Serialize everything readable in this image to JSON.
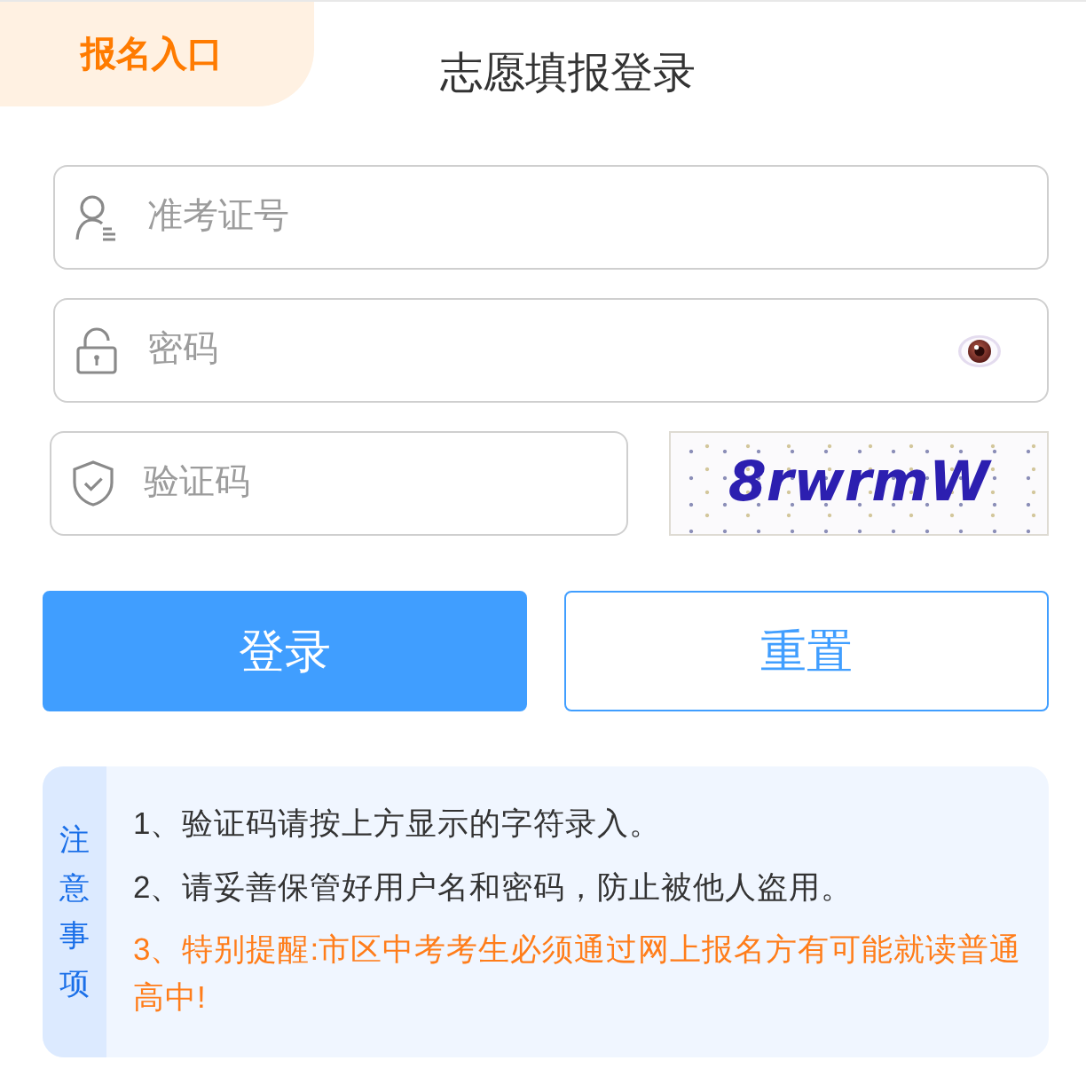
{
  "header": {
    "tab": "报名入口",
    "title": "志愿填报登录"
  },
  "form": {
    "fields": [
      {
        "kind": "username",
        "placeholder": "准考证号"
      },
      {
        "kind": "password",
        "placeholder": "密码"
      },
      {
        "kind": "captcha",
        "placeholder": "验证码"
      }
    ],
    "captcha_image": {
      "text": "8rwrmW"
    }
  },
  "buttons": [
    {
      "kind": "primary",
      "label": "登录"
    },
    {
      "kind": "outline",
      "label": "重置"
    }
  ],
  "notice": {
    "heading": "注意事项",
    "items": [
      {
        "kind": "normal",
        "text": "1、验证码请按上方显示的字符录入。"
      },
      {
        "kind": "normal",
        "text": "2、请妥善保管好用户名和密码，防止被他人盗用。"
      },
      {
        "kind": "warning",
        "text": "3、特别提醒:市区中考考生必须通过网上报名方有可能就读普通高中!"
      }
    ]
  }
}
